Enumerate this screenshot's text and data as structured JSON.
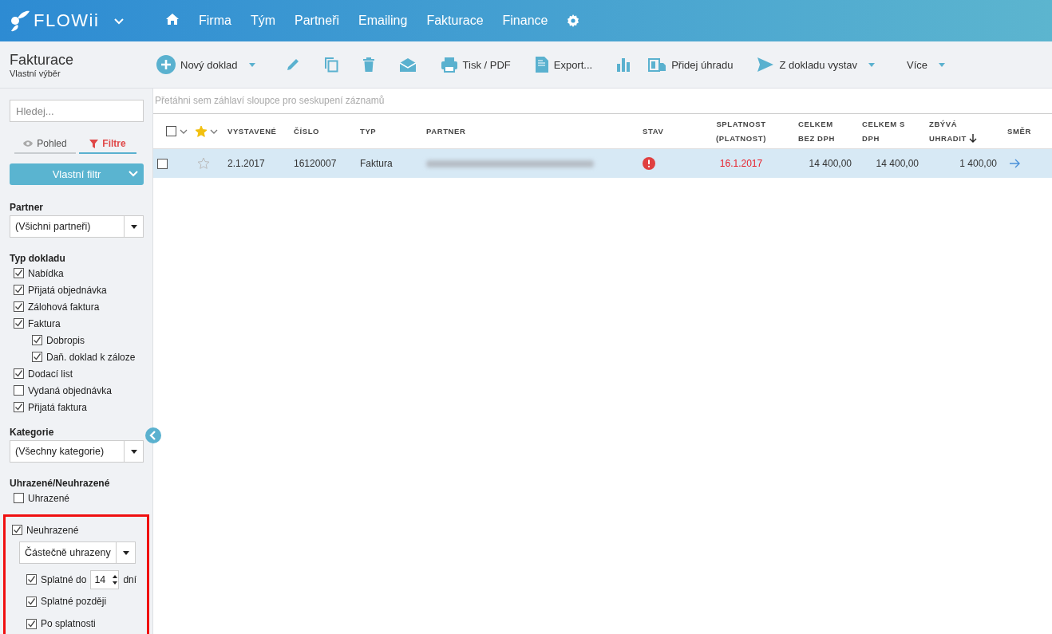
{
  "header": {
    "logo": "FLOWii",
    "nav": [
      {
        "label": "Firma"
      },
      {
        "label": "Tým"
      },
      {
        "label": "Partneři"
      },
      {
        "label": "Emailing"
      },
      {
        "label": "Fakturace"
      },
      {
        "label": "Finance"
      }
    ]
  },
  "page": {
    "title": "Fakturace",
    "subtitle": "Vlastní výběr"
  },
  "toolbar": [
    {
      "label": "Nový doklad",
      "dropdown": true
    },
    {
      "dropdown": false
    },
    {
      "dropdown": false
    },
    {
      "dropdown": false
    },
    {
      "dropdown": false
    },
    {
      "label": "Tisk / PDF",
      "dropdown": false
    },
    {
      "label": "Export...",
      "dropdown": false
    },
    {
      "dropdown": false
    },
    {
      "label": "Přidej úhradu",
      "dropdown": false
    },
    {
      "label": "Z dokladu vystav",
      "dropdown": true
    },
    {
      "label": "Více",
      "dropdown": true
    }
  ],
  "sidebar": {
    "search": {
      "placeholder": "Hledej..."
    },
    "tabs": [
      {
        "label": "Pohled",
        "selected": false
      },
      {
        "label": "Filtre",
        "selected": true
      }
    ],
    "filter_button": "Vlastní filtr",
    "partner": {
      "label": "Partner",
      "value": "(Všichni partneři)"
    },
    "doc_types": {
      "label": "Typ dokladu",
      "items": [
        {
          "label": "Nabídka",
          "checked": true
        },
        {
          "label": "Přijatá objednávka",
          "checked": true
        },
        {
          "label": "Zálohová faktura",
          "checked": true
        },
        {
          "label": "Faktura",
          "checked": true,
          "children": [
            {
              "label": "Dobropis",
              "checked": true
            },
            {
              "label": "Daň. doklad k záloze",
              "checked": true
            }
          ]
        },
        {
          "label": "Dodací list",
          "checked": true
        },
        {
          "label": "Vydaná objednávka",
          "checked": false
        },
        {
          "label": "Přijatá faktura",
          "checked": true
        }
      ]
    },
    "category": {
      "label": "Kategorie",
      "value": "(Všechny kategorie)"
    },
    "payment": {
      "label": "Uhrazené/Neuhrazené",
      "paid": {
        "label": "Uhrazené",
        "checked": false
      },
      "unpaid": {
        "label": "Neuhrazené",
        "checked": true,
        "highlighted": true,
        "mode": "Částečně uhrazeny",
        "options": [
          {
            "kind": "days",
            "label": "Splatné do",
            "value": "14",
            "unit": "dní",
            "checked": true
          },
          {
            "kind": "check",
            "label": "Splatné později",
            "checked": true
          },
          {
            "kind": "check",
            "label": "Po splatnosti",
            "checked": true
          }
        ]
      }
    }
  },
  "grid": {
    "group_hint": "Přetáhni sem záhlaví sloupce pro seskupení záznamů",
    "all_checked": false,
    "star_filter": true,
    "columns": [
      {
        "lines": [
          "VYSTAVENÉ"
        ]
      },
      {
        "lines": [
          "ČÍSLO"
        ]
      },
      {
        "lines": [
          "TYP"
        ]
      },
      {
        "lines": [
          "PARTNER"
        ]
      },
      {
        "lines": [
          "STAV"
        ]
      },
      {
        "lines": [
          "SPLATNOST",
          "(PLATNOST)"
        ]
      },
      {
        "lines": [
          "CELKEM",
          "BEZ DPH"
        ]
      },
      {
        "lines": [
          "CELKEM S",
          "DPH"
        ]
      },
      {
        "lines": [
          "ZBÝVÁ",
          "UHRADIT"
        ],
        "sorted": true
      },
      {
        "lines": [
          "SMĚR"
        ]
      }
    ],
    "rows": [
      {
        "selected": true,
        "checked": false,
        "starred": false,
        "issued": "2.1.2017",
        "number": "16120007",
        "type": "Faktura",
        "alert": true,
        "due": "16.1.2017",
        "overdue": true,
        "net": "14 400,00",
        "gross": "14 400,00",
        "remaining": "1 400,00"
      }
    ]
  }
}
